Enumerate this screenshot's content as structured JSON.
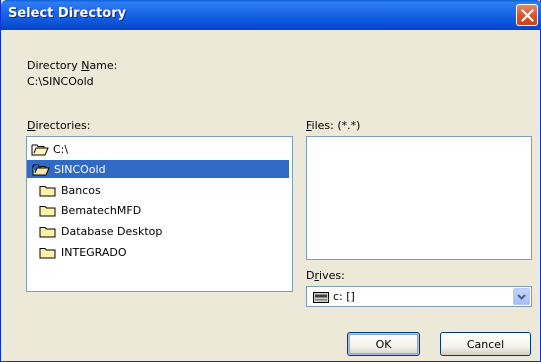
{
  "window": {
    "title": "Select Directory",
    "close_icon": "close-icon"
  },
  "directory_name": {
    "label_pre": "Directory ",
    "label_accel": "N",
    "label_post": "ame:",
    "value": "C:\\SINCOold"
  },
  "directories": {
    "label_accel": "D",
    "label_post": "irectories:",
    "items": [
      {
        "label": "C:\\",
        "icon": "open-folder-icon",
        "indent": 0,
        "selected": false
      },
      {
        "label": "SINCOold",
        "icon": "open-folder-icon",
        "indent": 1,
        "selected": true
      },
      {
        "label": "Bancos",
        "icon": "folder-icon",
        "indent": 2,
        "selected": false
      },
      {
        "label": "BematechMFD",
        "icon": "folder-icon",
        "indent": 2,
        "selected": false
      },
      {
        "label": "Database Desktop",
        "icon": "folder-icon",
        "indent": 2,
        "selected": false
      },
      {
        "label": "INTEGRADO",
        "icon": "folder-icon",
        "indent": 2,
        "selected": false
      }
    ]
  },
  "files": {
    "label_accel": "F",
    "label_post": "iles: (*.*)",
    "items": []
  },
  "drives": {
    "label_pre": "D",
    "label_accel": "r",
    "label_post": "ives:",
    "selected": "c: []",
    "icon": "drive-icon"
  },
  "buttons": {
    "ok": "OK",
    "cancel": "Cancel"
  },
  "colors": {
    "selection": "#316ac5",
    "titlebar": "#0a52d6",
    "face": "#ece9d8"
  }
}
